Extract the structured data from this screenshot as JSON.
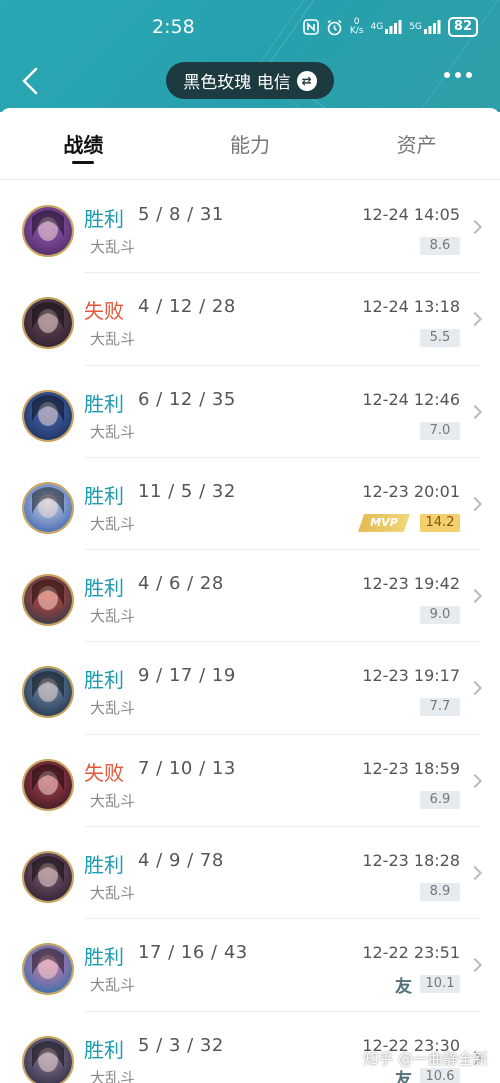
{
  "status_bar": {
    "time": "2:58",
    "net_speed": "0\nK/s",
    "signal_4g": "4G",
    "signal_5g": "5G",
    "battery": "82",
    "icons": [
      "nfc-icon",
      "alarm-icon",
      "signal-4g-icon",
      "signal-5g-icon",
      "battery-icon"
    ]
  },
  "header": {
    "title": "黑色玫瑰 电信",
    "swap_icon": "⇄",
    "back_icon": "chevron-left-icon",
    "more_icon": "more-dots-icon",
    "bg_color": "#2aa7b3",
    "pill_color": "#1c3a40"
  },
  "tabs": [
    {
      "label": "战绩",
      "active": true
    },
    {
      "label": "能力",
      "active": false
    },
    {
      "label": "资产",
      "active": false
    }
  ],
  "colors": {
    "win": "#1c9bb0",
    "loss": "#e4563a",
    "mvp_gold": "#f6cf6d"
  },
  "matches": [
    {
      "result": "胜利",
      "outcome": "win",
      "kda": "5 / 8 / 31",
      "mode": "大乱斗",
      "time": "12-24 14:05",
      "score": "8.6",
      "mvp": false,
      "friend": false,
      "avatar_colors": [
        "#4a2a5e",
        "#9a5bbf"
      ]
    },
    {
      "result": "失败",
      "outcome": "loss",
      "kda": "4 / 12 / 28",
      "mode": "大乱斗",
      "time": "12-24 13:18",
      "score": "5.5",
      "mvp": false,
      "friend": false,
      "avatar_colors": [
        "#2a1f2a",
        "#6b4a5e"
      ]
    },
    {
      "result": "胜利",
      "outcome": "win",
      "kda": "6 / 12 / 35",
      "mode": "大乱斗",
      "time": "12-24 12:46",
      "score": "7.0",
      "mvp": false,
      "friend": false,
      "avatar_colors": [
        "#1c2f5a",
        "#4b6bb8"
      ]
    },
    {
      "result": "胜利",
      "outcome": "win",
      "kda": "11 / 5 / 32",
      "mode": "大乱斗",
      "time": "12-23 20:01",
      "score": "14.2",
      "mvp": true,
      "mvp_label": "MVP",
      "friend": false,
      "avatar_colors": [
        "#3c5fa8",
        "#c9d8f0"
      ]
    },
    {
      "result": "胜利",
      "outcome": "win",
      "kda": "4 / 6 / 28",
      "mode": "大乱斗",
      "time": "12-23 19:42",
      "score": "9.0",
      "mvp": false,
      "friend": false,
      "avatar_colors": [
        "#2b3c4a",
        "#d4453a"
      ]
    },
    {
      "result": "胜利",
      "outcome": "win",
      "kda": "9 / 17 / 19",
      "mode": "大乱斗",
      "time": "12-23 19:17",
      "score": "7.7",
      "mvp": false,
      "friend": false,
      "avatar_colors": [
        "#223048",
        "#6f8fb0"
      ]
    },
    {
      "result": "失败",
      "outcome": "loss",
      "kda": "7 / 10 / 13",
      "mode": "大乱斗",
      "time": "12-23 18:59",
      "score": "6.9",
      "mvp": false,
      "friend": false,
      "avatar_colors": [
        "#3a1a22",
        "#b04050"
      ]
    },
    {
      "result": "胜利",
      "outcome": "win",
      "kda": "4 / 9 / 78",
      "mode": "大乱斗",
      "time": "12-23 18:28",
      "score": "8.9",
      "mvp": false,
      "friend": false,
      "avatar_colors": [
        "#2e2030",
        "#7a5a70"
      ]
    },
    {
      "result": "胜利",
      "outcome": "win",
      "kda": "17 / 16 / 43",
      "mode": "大乱斗",
      "time": "12-22 23:51",
      "score": "10.1",
      "mvp": false,
      "friend": true,
      "friend_label": "友",
      "avatar_colors": [
        "#2a6fa8",
        "#e07ab0"
      ]
    },
    {
      "result": "胜利",
      "outcome": "win",
      "kda": "5 / 3 / 32",
      "mode": "大乱斗",
      "time": "12-22 23:30",
      "score": "10.6",
      "mvp": false,
      "friend": true,
      "friend_label": "友",
      "avatar_colors": [
        "#2a2a3a",
        "#8a7aa0"
      ]
    }
  ],
  "watermark": "知乎 @一曲静全新"
}
